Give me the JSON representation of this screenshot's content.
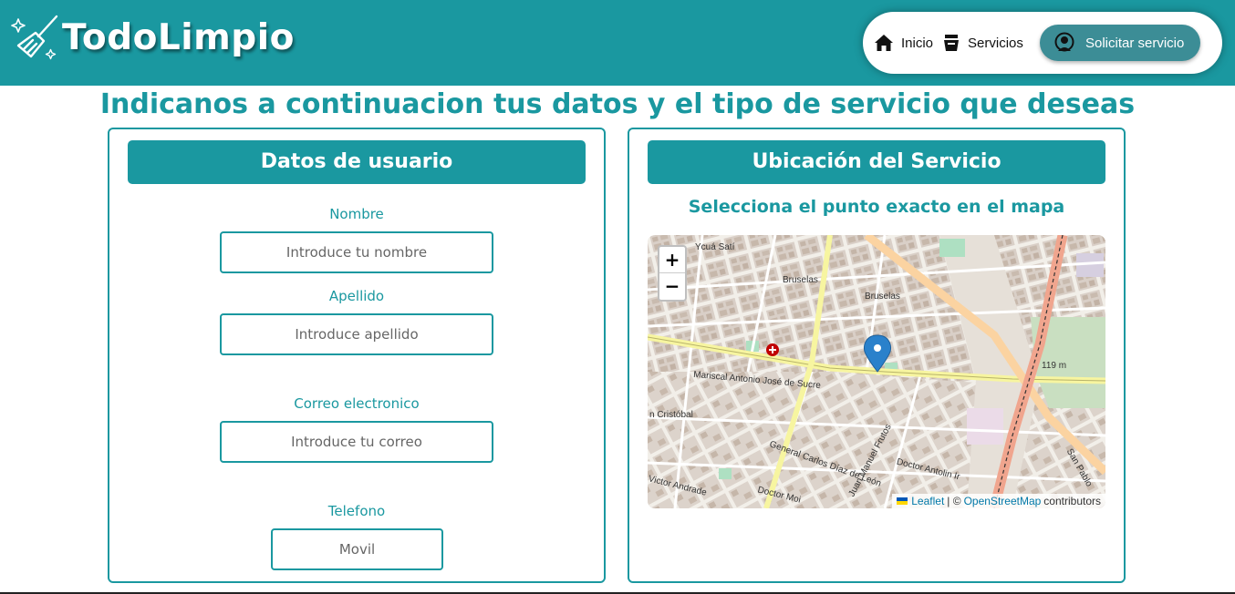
{
  "app": {
    "name": "TodoLimpio"
  },
  "nav": {
    "items": [
      {
        "label": "Inicio",
        "icon": "home-icon"
      },
      {
        "label": "Servicios",
        "icon": "bucket-icon"
      }
    ],
    "cta": {
      "label": "Solicitar servicio",
      "icon": "cleaner-icon"
    }
  },
  "page": {
    "title": "Indicanos a continuacion tus datos y el tipo de servicio que deseas"
  },
  "user_panel": {
    "header": "Datos de usuario",
    "fields": [
      {
        "label": "Nombre",
        "placeholder": "Introduce tu nombre"
      },
      {
        "label": "Apellido",
        "placeholder": "Introduce apellido"
      },
      {
        "label": "Correo electronico",
        "placeholder": "Introduce tu correo"
      },
      {
        "label": "Telefono",
        "placeholder": "Movil"
      }
    ]
  },
  "location_panel": {
    "header": "Ubicación del Servicio",
    "subtitle": "Selecciona el punto exacto en el mapa",
    "map": {
      "zoom_in": "+",
      "zoom_out": "−",
      "attribution": {
        "leaflet": "Leaflet",
        "separator": "| ©",
        "osm": "OpenStreetMap",
        "contributors": "contributors"
      },
      "labels": {
        "ycua_sati": "Ycuá Satí",
        "bruselas1": "Bruselas",
        "bruselas2": "Bruselas",
        "mariscal": "Mariscal Antonio José de Sucre",
        "cristobal": "n Cristóbal",
        "elevation": "119 m",
        "victor": "Victor Andrade",
        "doctor_moi": "Doctor Moi",
        "doctor_antolin": "Doctor Antolin Ir",
        "juan_manuel": "Juan Manuel Frutos",
        "general_carlos": "General Carlos Díaz de León",
        "san_pablo": "San Pablo"
      }
    }
  }
}
